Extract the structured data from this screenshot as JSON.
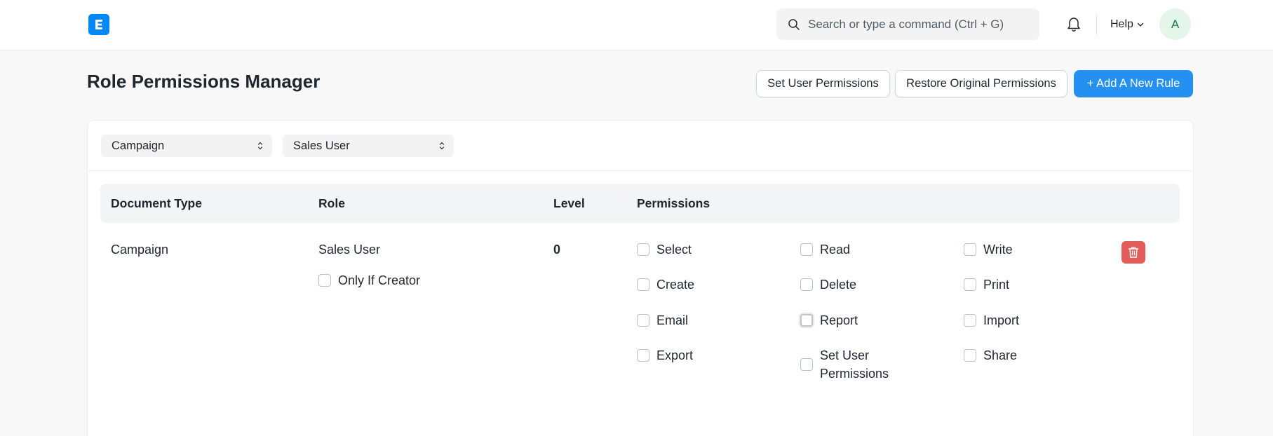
{
  "navbar": {
    "search_placeholder": "Search or type a command (Ctrl + G)",
    "help_label": "Help",
    "avatar_initial": "A"
  },
  "page": {
    "title": "Role Permissions Manager",
    "buttons": {
      "set_user_permissions": "Set User Permissions",
      "restore_original": "Restore Original Permissions",
      "add_rule": "+ Add A New Rule"
    }
  },
  "filters": {
    "document_type": "Campaign",
    "role": "Sales User"
  },
  "table": {
    "headers": {
      "document_type": "Document Type",
      "role": "Role",
      "level": "Level",
      "permissions": "Permissions"
    },
    "row": {
      "document_type": "Campaign",
      "role": "Sales User",
      "only_if_creator": "Only If Creator",
      "level": "0",
      "permissions": {
        "select": "Select",
        "read": "Read",
        "write": "Write",
        "create": "Create",
        "delete": "Delete",
        "print": "Print",
        "email": "Email",
        "report": "Report",
        "import": "Import",
        "export": "Export",
        "set_user_permissions_line1": "Set User",
        "set_user_permissions_line2": "Permissions",
        "share": "Share"
      }
    }
  },
  "colors": {
    "primary": "#2490ef",
    "logo": "#0289f7",
    "danger": "#e25c5c",
    "avatar_bg": "#e4f5e9",
    "avatar_fg": "#16794c"
  }
}
